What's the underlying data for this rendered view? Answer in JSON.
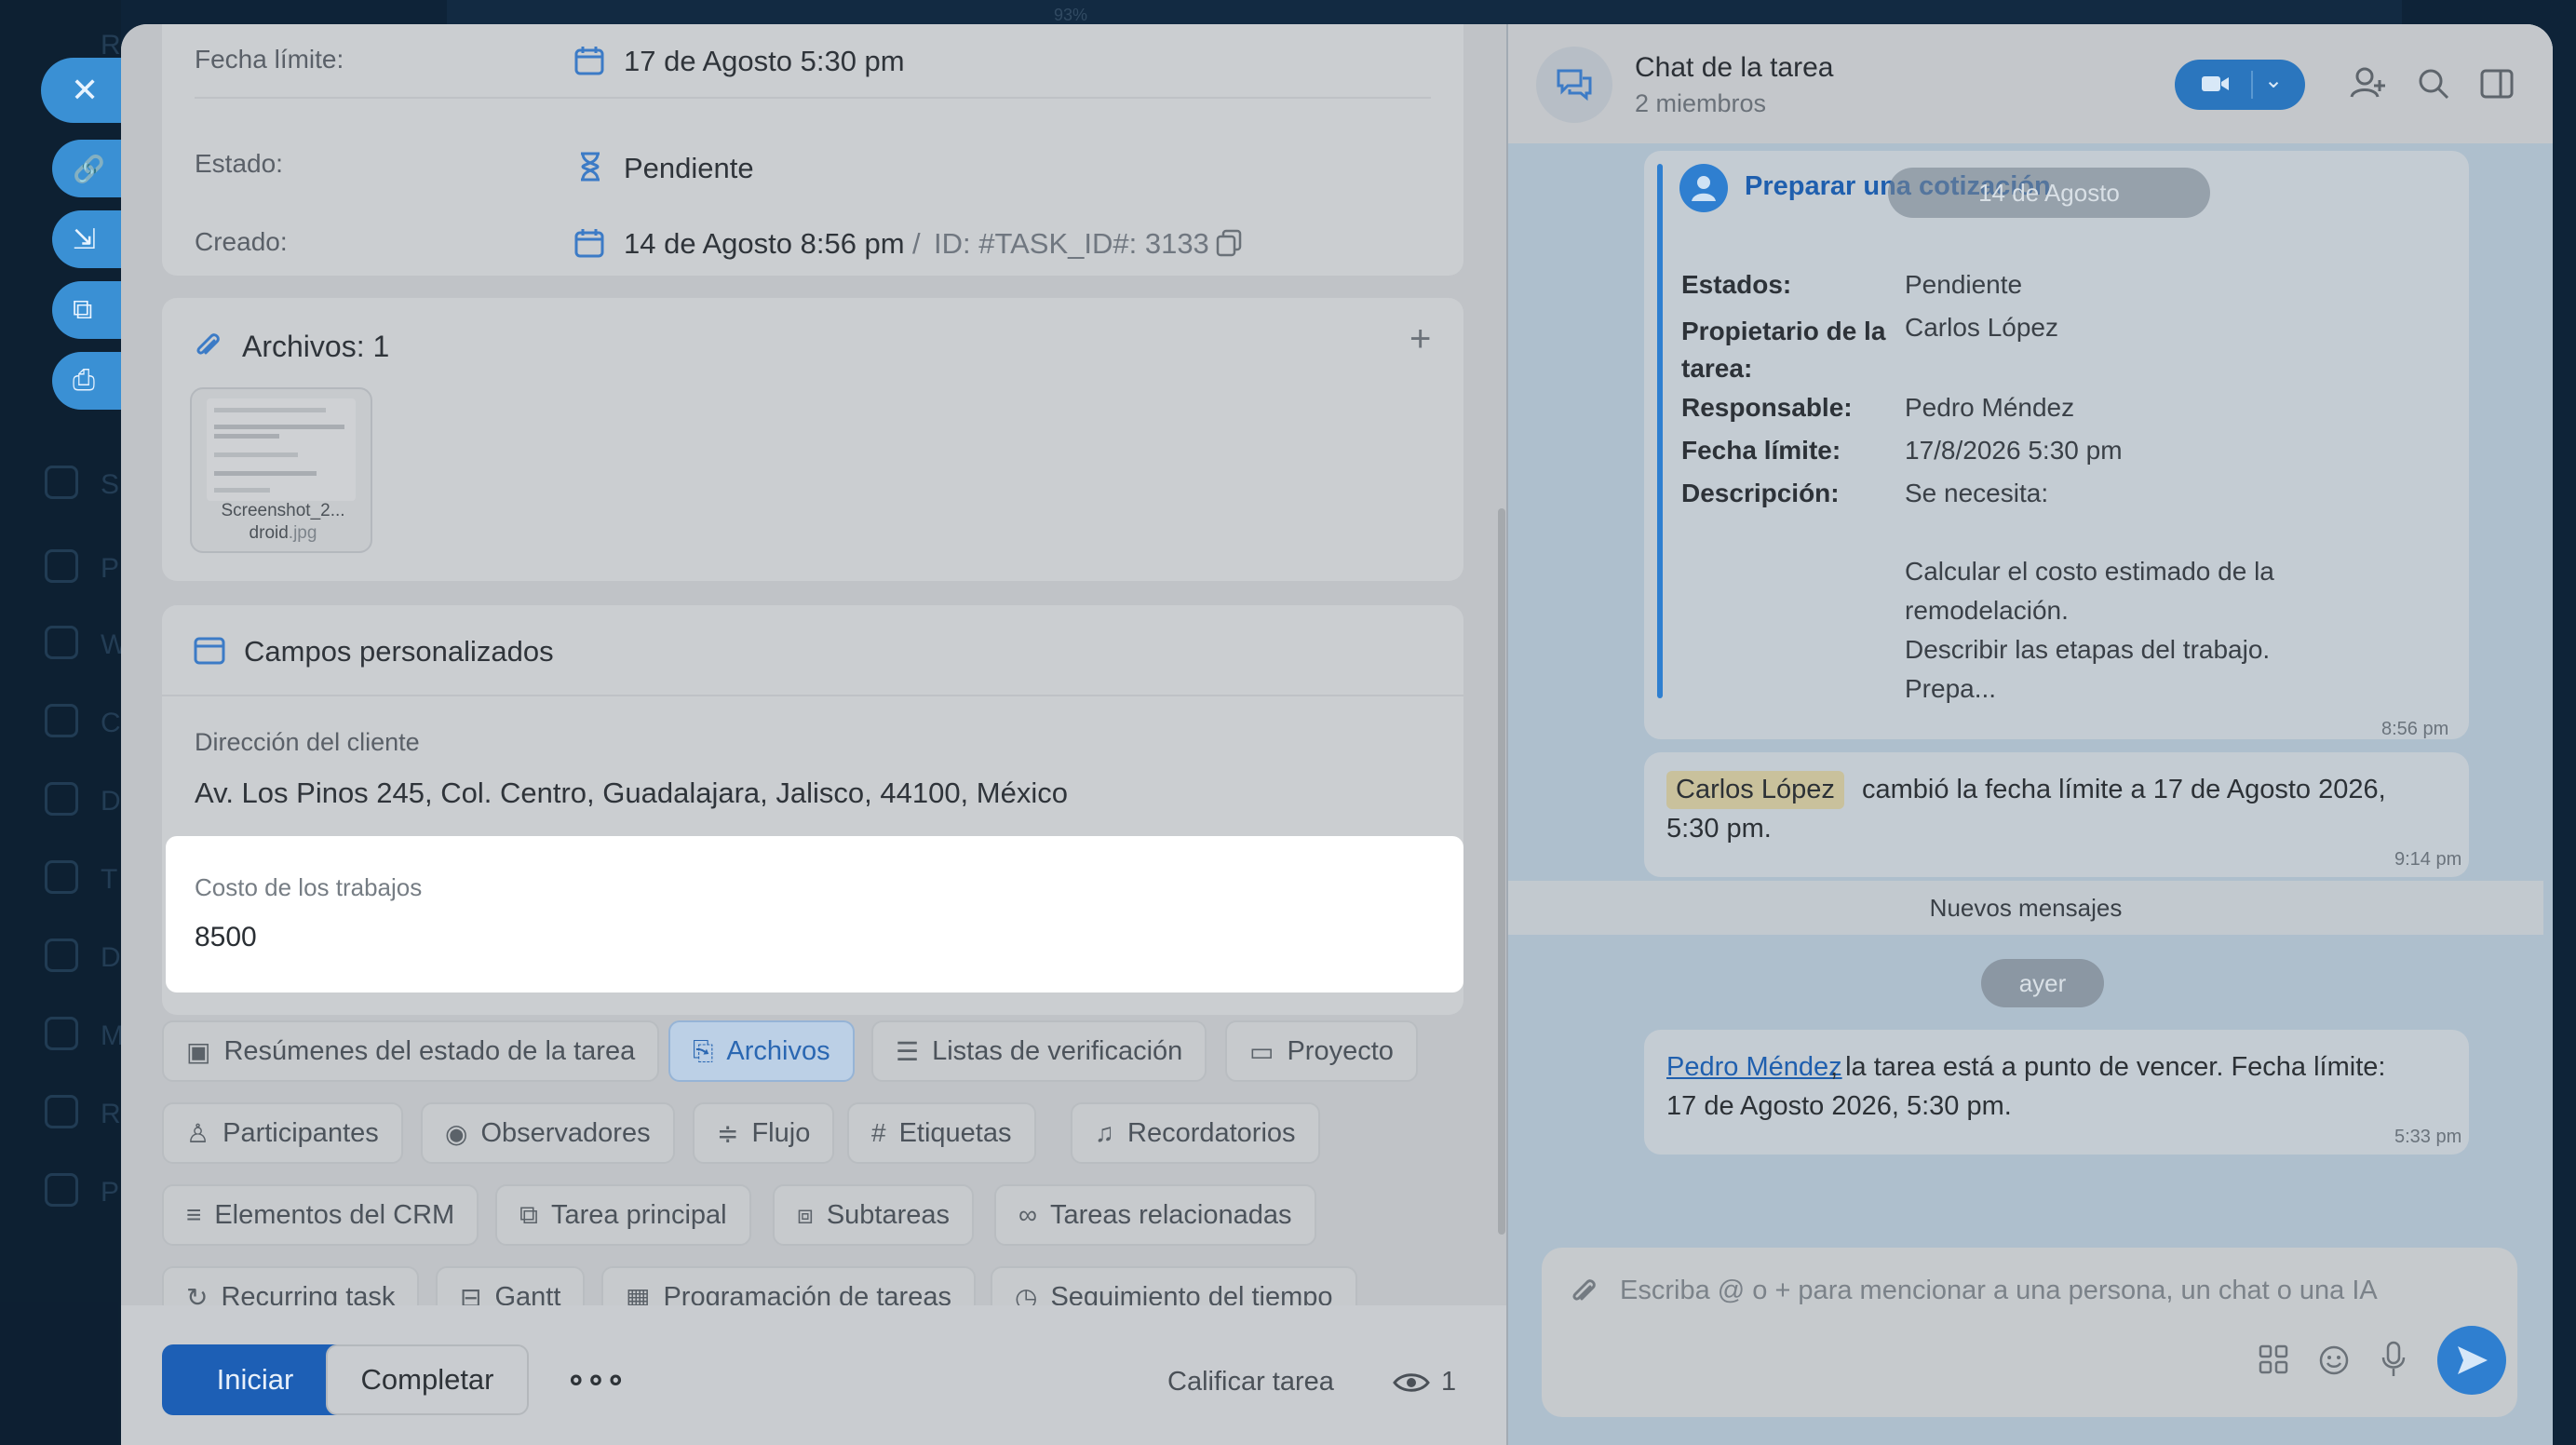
{
  "background": {
    "sidebar_letters": [
      "R",
      "S",
      "P",
      "W",
      "C",
      "D",
      "T",
      "D",
      "M",
      "R",
      "P"
    ],
    "zoom": "93%"
  },
  "float_buttons": {
    "close": "✕",
    "link": "🔗",
    "minimize": "⇲",
    "open": "⧉",
    "print": "⎙"
  },
  "task": {
    "deadline_label": "Fecha límite:",
    "deadline_value": "17 de Agosto 5:30 pm",
    "status_label": "Estado:",
    "status_value": "Pendiente",
    "created_label": "Creado:",
    "created_value": "14 de Agosto 8:56 pm",
    "separator": "/",
    "id_value": "ID: #TASK_ID#: 3133"
  },
  "files": {
    "title": "Archivos: 1",
    "add": "+",
    "thumb_line1": "Screenshot_2...",
    "thumb_line2_name": "droid",
    "thumb_line2_ext": ".jpg"
  },
  "custom_fields": {
    "title": "Campos personalizados",
    "address_label": "Dirección del cliente",
    "address_value": "Av. Los Pinos 245, Col. Centro, Guadalajara, Jalisco, 44100, México",
    "cost_label": "Costo de los trabajos",
    "cost_value": "8500"
  },
  "tabs": [
    {
      "label": "Resúmenes del estado de la tarea",
      "icon": "▣",
      "active": false
    },
    {
      "label": "Archivos",
      "icon": "⎘",
      "active": true
    },
    {
      "label": "Listas de verificación",
      "icon": "☰",
      "active": false
    },
    {
      "label": "Proyecto",
      "icon": "▭",
      "active": false
    },
    {
      "label": "Participantes",
      "icon": "♙",
      "active": false
    },
    {
      "label": "Observadores",
      "icon": "◉",
      "active": false
    },
    {
      "label": "Flujo",
      "icon": "≑",
      "active": false
    },
    {
      "label": "Etiquetas",
      "icon": "#",
      "active": false
    },
    {
      "label": "Recordatorios",
      "icon": "♫",
      "active": false
    },
    {
      "label": "Elementos del CRM",
      "icon": "≡",
      "active": false
    },
    {
      "label": "Tarea principal",
      "icon": "⧉",
      "active": false
    },
    {
      "label": "Subtareas",
      "icon": "⧈",
      "active": false
    },
    {
      "label": "Tareas relacionadas",
      "icon": "∞",
      "active": false
    },
    {
      "label": "Recurring task",
      "icon": "↻",
      "active": false
    },
    {
      "label": "Gantt",
      "icon": "⊟",
      "active": false
    },
    {
      "label": "Programación de tareas",
      "icon": "▦",
      "active": false
    },
    {
      "label": "Seguimiento del tiempo",
      "icon": "◷",
      "active": false
    }
  ],
  "footer": {
    "start": "Iniciar",
    "complete": "Completar",
    "more": "∘∘∘",
    "rate": "Calificar tarea",
    "views": "1"
  },
  "chat": {
    "title": "Chat de la tarea",
    "members": "2 miembros",
    "date_pill_top": "14 de Agosto",
    "card_title": "Preparar una cotización",
    "fields": [
      {
        "label": "Estados:",
        "value": "Pendiente"
      },
      {
        "label": "Propietario de la tarea:",
        "value": "Carlos López"
      },
      {
        "label": "Responsable:",
        "value": "Pedro Méndez"
      },
      {
        "label": "Fecha límite:",
        "value": "17/8/2026 5:30 pm"
      },
      {
        "label": "Descripción:",
        "value": "Se necesita:"
      }
    ],
    "desc_lines": [
      "Calcular el costo estimado de la",
      "remodelación.",
      "Describir las etapas del trabajo.",
      "Prepa..."
    ],
    "time1": "8:56 pm",
    "msg2_name": "Carlos López",
    "msg2_text1": "cambió la fecha límite a 17 de Agosto 2026,",
    "msg2_text2": "5:30 pm.",
    "time2": "9:14 pm",
    "new_messages": "Nuevos mensajes",
    "date_pill_yesterday": "ayer",
    "msg3_name": "Pedro Méndez",
    "msg3_text1": ", la tarea está a punto de vencer. Fecha límite:",
    "msg3_text2": "17 de Agosto 2026, 5:30 pm.",
    "time3": "5:33 pm",
    "input_placeholder": "Escriba @ o + para mencionar a una persona, un chat o una IA"
  },
  "colors": {
    "accent": "#2f7fd0",
    "primary_button": "#1d5fb5",
    "highlight": "#ffffff"
  }
}
